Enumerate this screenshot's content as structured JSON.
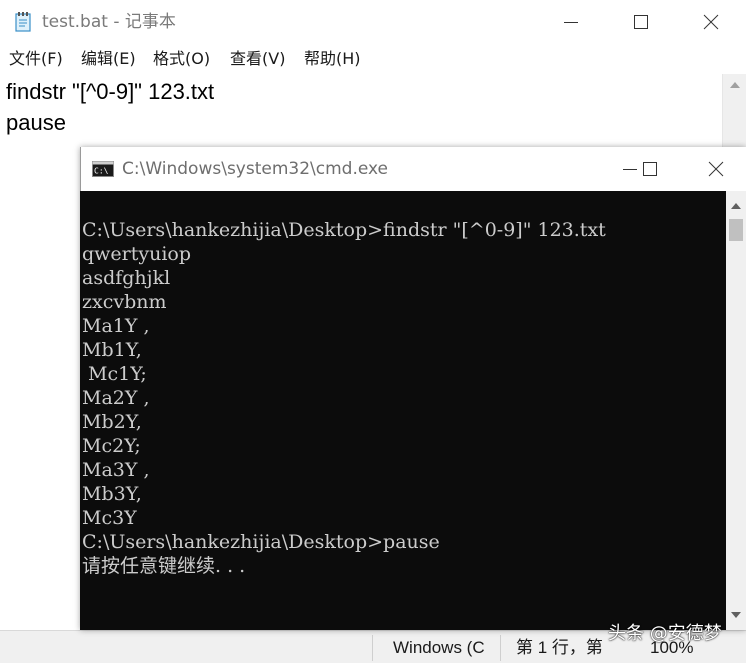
{
  "notepad": {
    "title": "test.bat - 记事本",
    "menu": [
      "文件(F)",
      "编辑(E)",
      "格式(O)",
      "查看(V)",
      "帮助(H)"
    ],
    "lines": [
      "findstr \"[^0-9]\" 123.txt",
      "pause"
    ],
    "status": {
      "encoding": "Windows (C",
      "position": "第 1 行，第",
      "zoom": "100%"
    }
  },
  "cmd": {
    "title": "C:\\Windows\\system32\\cmd.exe",
    "lines": [
      "C:\\Users\\hankezhijia\\Desktop>findstr \"[^0-9]\" 123.txt",
      "qwertyuiop",
      "asdfghjkl",
      "zxcvbnm",
      "Ma1Y ,",
      "Mb1Y,",
      " Mc1Y;",
      "Ma2Y ,",
      "Mb2Y,",
      "Mc2Y;",
      "Ma3Y ,",
      "Mb3Y,",
      "Mc3Y",
      "C:\\Users\\hankezhijia\\Desktop>pause",
      "请按任意键继续. . ."
    ]
  },
  "watermark": "头条 @安德梦",
  "colors": {
    "console_bg": "#0c0c0c",
    "console_text": "#cccccc",
    "chrome_bg": "#f0f0f0"
  },
  "icons": [
    "notepad-icon",
    "cmd-icon",
    "minimize-icon",
    "maximize-icon",
    "close-icon"
  ]
}
